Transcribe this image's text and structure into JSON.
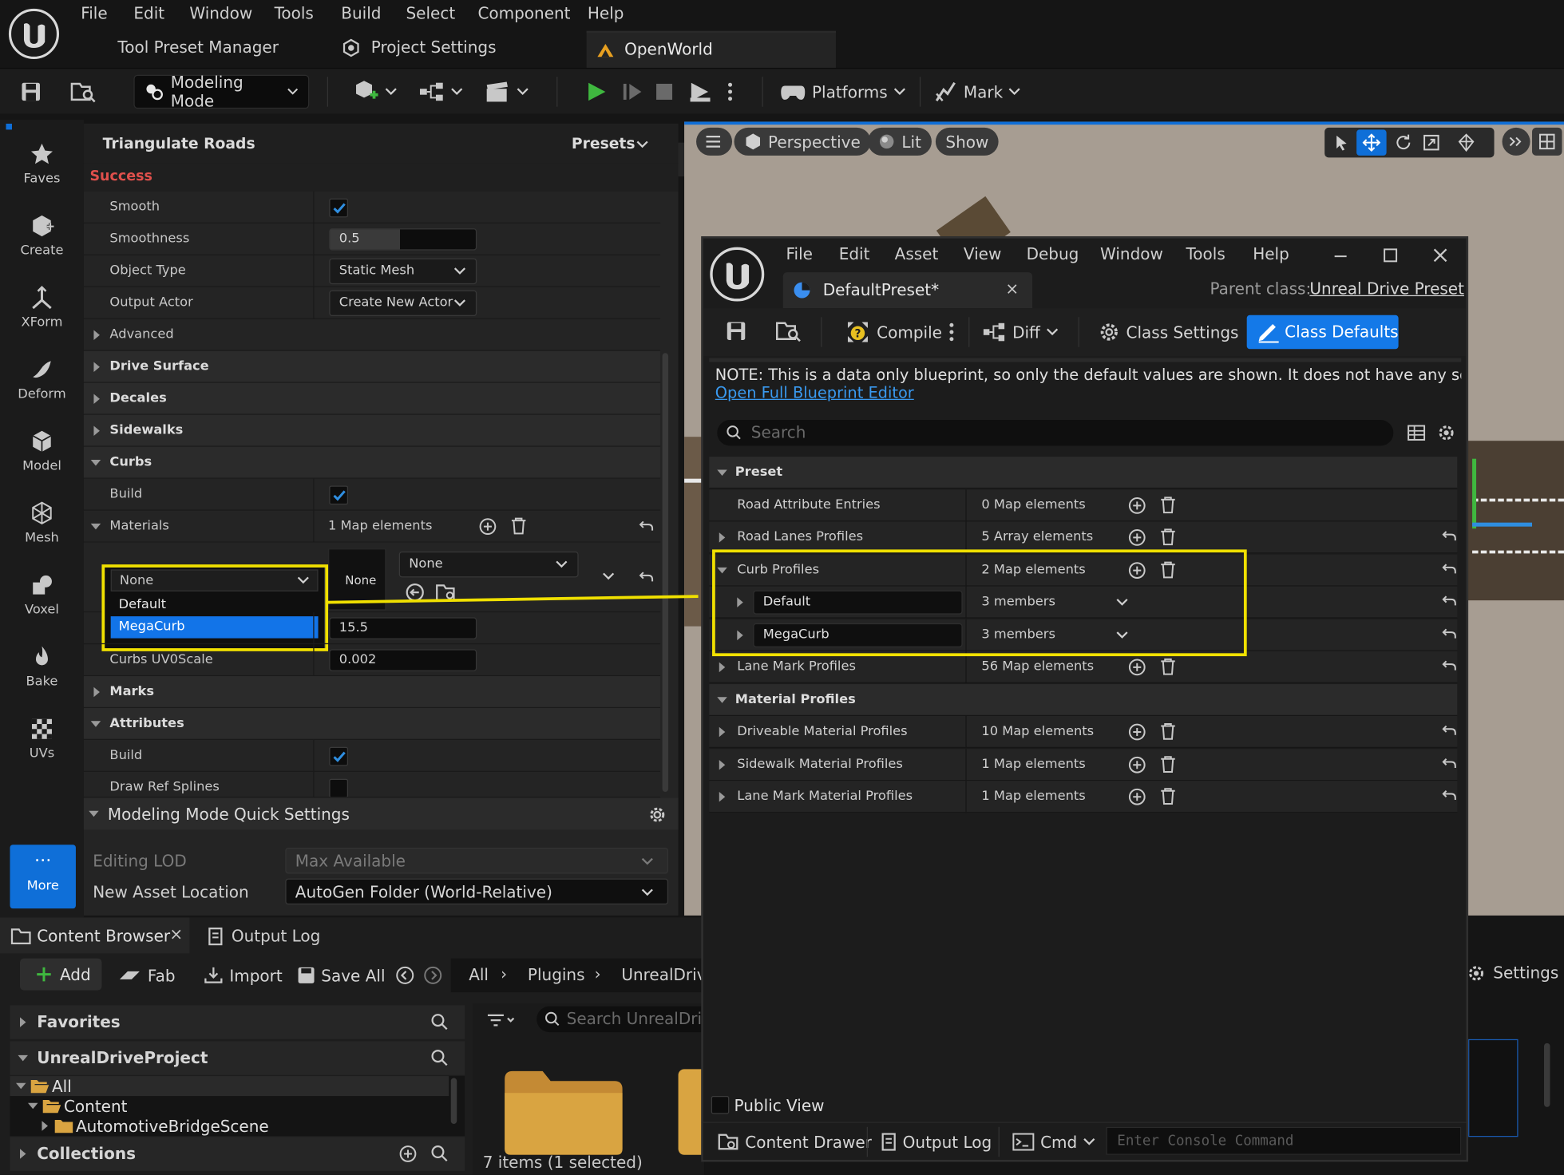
{
  "menu": {
    "items": [
      "File",
      "Edit",
      "Window",
      "Tools",
      "Build",
      "Select",
      "Component",
      "Help"
    ]
  },
  "tabs": {
    "tool_preset": "Tool Preset Manager",
    "project_settings": "Project Settings",
    "openworld": "OpenWorld"
  },
  "toolbar": {
    "mode": "Modeling Mode",
    "platforms": "Platforms",
    "mark": "Mark"
  },
  "leftbar": {
    "items": [
      "Faves",
      "Create",
      "XForm",
      "Deform",
      "Model",
      "Mesh",
      "Voxel",
      "Bake",
      "UVs"
    ],
    "more": "More"
  },
  "details": {
    "title": "Triangulate Roads",
    "presets": "Presets",
    "status": "Success",
    "smooth": "Smooth",
    "smoothness": "Smoothness",
    "smoothness_val": "0.5",
    "object_type": "Object Type",
    "object_type_val": "Static Mesh",
    "output_actor": "Output Actor",
    "output_actor_val": "Create New Actor",
    "advanced": "Advanced",
    "drive_surface": "Drive Surface",
    "decales": "Decales",
    "sidewalks": "Sidewalks",
    "curbs": "Curbs",
    "build": "Build",
    "materials": "Materials",
    "materials_val": "1 Map elements",
    "key_dropdown": "None",
    "thumb_label": "None",
    "material_val": "None",
    "popup_options": [
      "Default",
      "MegaCurb"
    ],
    "hidden_val": "15.5",
    "curbs_uv": "Curbs UV0Scale",
    "curbs_uv_val": "0.002",
    "marks": "Marks",
    "attributes": "Attributes",
    "attr_build": "Build",
    "draw_ref": "Draw Ref Splines"
  },
  "quick": {
    "title": "Modeling Mode Quick Settings",
    "lod_label": "Editing LOD",
    "lod_val": "Max Available",
    "asset_loc_label": "New Asset Location",
    "asset_loc_val": "AutoGen Folder (World-Relative)"
  },
  "viewport": {
    "perspective": "Perspective",
    "lit": "Lit",
    "show": "Show"
  },
  "content_browser": {
    "tab": "Content Browser",
    "output_log": "Output Log",
    "add": "Add",
    "fab": "Fab",
    "import": "Import",
    "save_all": "Save All",
    "crumbs": [
      "All",
      "Plugins",
      "UnrealDrive"
    ],
    "settings": "Settings",
    "favorites": "Favorites",
    "project": "UnrealDriveProject",
    "tree": [
      "All",
      "Content",
      "AutomotiveBridgeScene"
    ],
    "collections": "Collections",
    "search_placeholder": "Search UnrealDrive",
    "status": "7 items (1 selected)"
  },
  "bp": {
    "menu": [
      "File",
      "Edit",
      "Asset",
      "View",
      "Debug",
      "Window",
      "Tools",
      "Help"
    ],
    "tab": "DefaultPreset*",
    "parent_label": "Parent class:",
    "parent_val": "Unreal Drive Preset",
    "compile": "Compile",
    "diff": "Diff",
    "class_settings": "Class Settings",
    "class_defaults": "Class Defaults",
    "note": "NOTE: This is a data only blueprint, so only the default values are shown.  It does not have any script or va",
    "open_full": "Open Full Blueprint Editor",
    "search_placeholder": "Search",
    "rows": [
      {
        "label": "Preset",
        "value": "",
        "kind": "cat"
      },
      {
        "label": "Road Attribute Entries",
        "value": "0 Map elements",
        "kind": "leaf"
      },
      {
        "label": "Road Lanes Profiles",
        "value": "5 Array elements",
        "kind": "collapsed"
      },
      {
        "label": "Curb Profiles",
        "value": "2 Map elements",
        "kind": "open"
      },
      {
        "label": "Default",
        "value": "3 members",
        "kind": "key"
      },
      {
        "label": "MegaCurb",
        "value": "3 members",
        "kind": "key"
      },
      {
        "label": "Lane Mark Profiles",
        "value": "56 Map elements",
        "kind": "collapsed"
      },
      {
        "label": "Material Profiles",
        "value": "",
        "kind": "cat"
      },
      {
        "label": "Driveable Material Profiles",
        "value": "10 Map elements",
        "kind": "collapsed"
      },
      {
        "label": "Sidewalk Material Profiles",
        "value": "1 Map elements",
        "kind": "collapsed"
      },
      {
        "label": "Lane Mark Material Profiles",
        "value": "1 Map elements",
        "kind": "collapsed"
      }
    ],
    "public_view": "Public View",
    "content_drawer": "Content Drawer",
    "output_log": "Output Log",
    "cmd": "Cmd",
    "console_placeholder": "Enter Console Command"
  },
  "colors": {
    "accent_blue": "#0f6fd8",
    "success_red": "#e0504c",
    "highlight_yellow": "#f0e000",
    "play_green": "#3fb83f"
  }
}
